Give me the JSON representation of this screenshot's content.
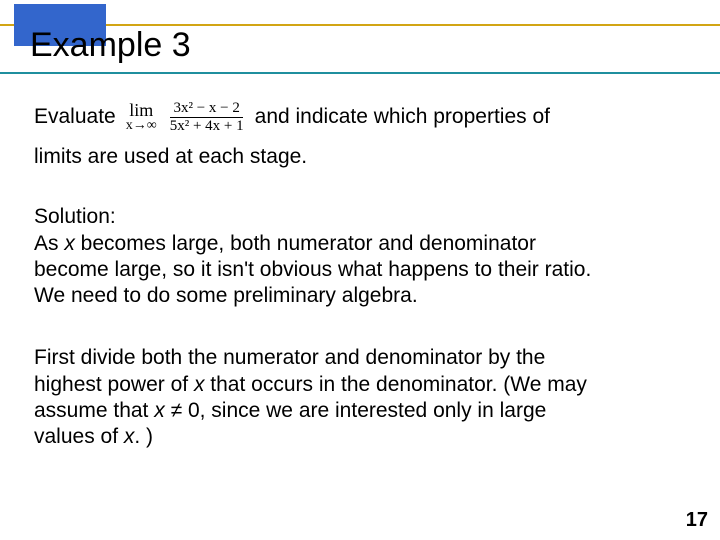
{
  "title": "Example 3",
  "row1": {
    "before": "Evaluate",
    "lim_text": "lim",
    "lim_sub": "x→∞",
    "numerator": "3x² − x − 2",
    "denominator": "5x² + 4x + 1",
    "after": "and indicate which properties of"
  },
  "line2": "limits are used at each stage.",
  "solution_label": "Solution:",
  "solution_body_l1": "As ",
  "solution_var1": "x",
  "solution_body_l1b": " becomes large, both numerator and denominator",
  "solution_body_l2": "become large, so it isn't obvious what happens to their ratio.",
  "solution_body_l3": "We need to do some preliminary algebra.",
  "first_l1": "First divide both the numerator and denominator by the",
  "first_l2a": "highest power of ",
  "first_var1": "x",
  "first_l2b": " that occurs in the denominator. (We may",
  "first_l3a": "assume that ",
  "first_var2": "x",
  "first_neq": " ≠ ",
  "first_zero": "0, since we are interested only in large",
  "first_l4a": "values of ",
  "first_var3": "x",
  "first_l4b": ". )",
  "page": "17"
}
